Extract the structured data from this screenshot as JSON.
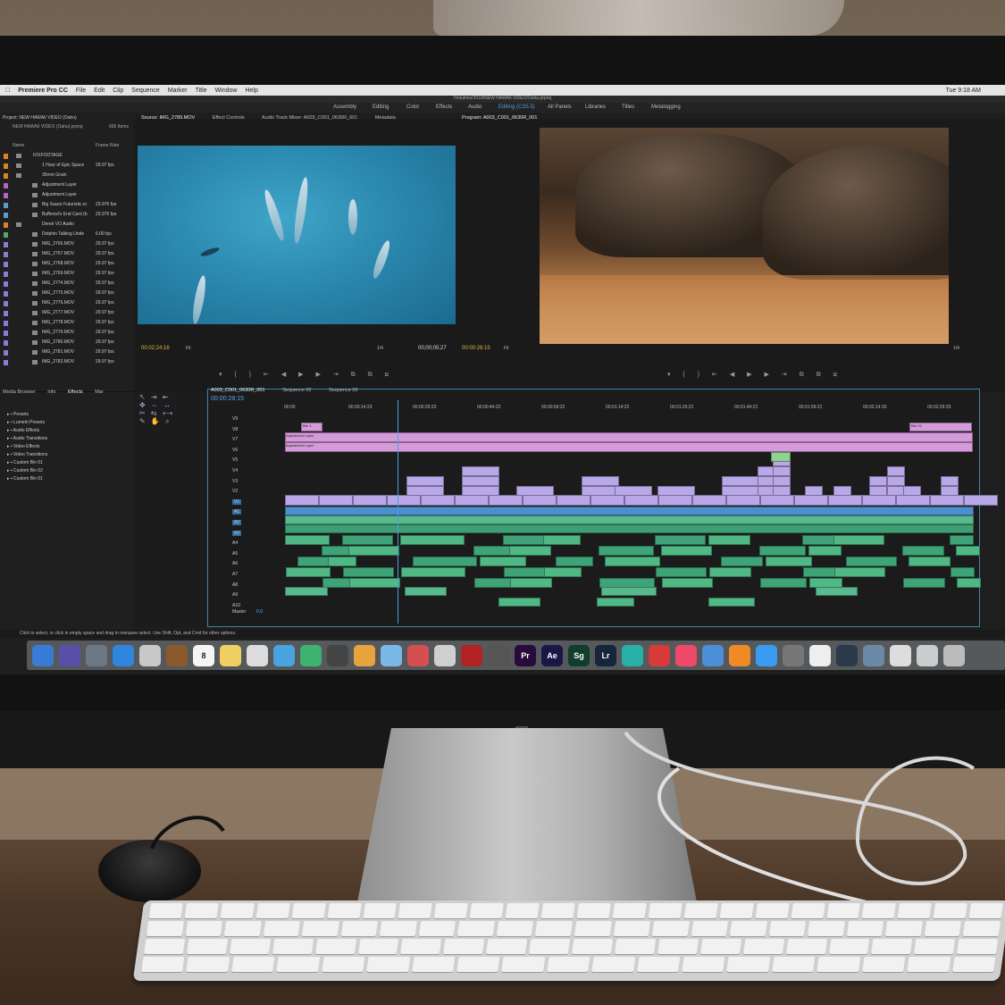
{
  "menubar": {
    "app_name": "Premiere Pro CC",
    "items": [
      "File",
      "Edit",
      "Clip",
      "Sequence",
      "Marker",
      "Title",
      "Window",
      "Help"
    ],
    "clock": "Tue 9:18 AM"
  },
  "window_title": "/Volumes/2018/NEW HAWAII VIDEO/Oahu.prproj",
  "workspaces": [
    "Assembly",
    "Editing",
    "Color",
    "Effects",
    "Audio",
    "Editing (CS5.5)",
    "All Panels",
    "Libraries",
    "Titles",
    "Metalogging"
  ],
  "project_panel": {
    "title": "Project: NEW HAWAII VIDEO (Oahu)",
    "file": "NEW HAWAII VIDEO (Oahu).prproj",
    "item_count": "665 Items",
    "columns": [
      "Name",
      "Frame Rate"
    ],
    "rows": [
      {
        "name": "IOXFOOTAGE",
        "fps": "",
        "color": "#d9822b"
      },
      {
        "name": "1 Hour of Epic Space",
        "fps": "29.97 fps",
        "color": "#d9822b"
      },
      {
        "name": "35mm Grain",
        "fps": "",
        "color": "#d9822b"
      },
      {
        "name": "Adjustment Layer",
        "fps": "",
        "color": "#b565c8"
      },
      {
        "name": "Adjustment Layer",
        "fps": "",
        "color": "#b565c8"
      },
      {
        "name": "Big Sauce Futuristic.m",
        "fps": "23.976 fps",
        "color": "#5c9ad6"
      },
      {
        "name": "Buffered's End Card (b",
        "fps": "23.976 fps",
        "color": "#5c9ad6"
      },
      {
        "name": "Derek VO Audio",
        "fps": "",
        "color": "#d9822b"
      },
      {
        "name": "Dolphin Talking Unde",
        "fps": "6.00 fps",
        "color": "#4cae6b"
      },
      {
        "name": "IMG_2766.MOV",
        "fps": "29.97 fps",
        "color": "#8c7ad8"
      },
      {
        "name": "IMG_2767.MOV",
        "fps": "29.97 fps",
        "color": "#8c7ad8"
      },
      {
        "name": "IMG_2768.MOV",
        "fps": "29.97 fps",
        "color": "#8c7ad8"
      },
      {
        "name": "IMG_2769.MOV",
        "fps": "29.97 fps",
        "color": "#8c7ad8"
      },
      {
        "name": "IMG_2774.MOV",
        "fps": "29.97 fps",
        "color": "#8c7ad8"
      },
      {
        "name": "IMG_2775.MOV",
        "fps": "29.97 fps",
        "color": "#8c7ad8"
      },
      {
        "name": "IMG_2776.MOV",
        "fps": "29.97 fps",
        "color": "#8c7ad8"
      },
      {
        "name": "IMG_2777.MOV",
        "fps": "29.97 fps",
        "color": "#8c7ad8"
      },
      {
        "name": "IMG_2778.MOV",
        "fps": "29.97 fps",
        "color": "#8c7ad8"
      },
      {
        "name": "IMG_2779.MOV",
        "fps": "29.97 fps",
        "color": "#8c7ad8"
      },
      {
        "name": "IMG_2780.MOV",
        "fps": "29.97 fps",
        "color": "#8c7ad8"
      },
      {
        "name": "IMG_2781.MOV",
        "fps": "29.97 fps",
        "color": "#8c7ad8"
      },
      {
        "name": "IMG_2782.MOV",
        "fps": "29.97 fps",
        "color": "#8c7ad8"
      }
    ]
  },
  "source_panel": {
    "tabs": [
      "Source: IMG_2789.MOV",
      "Effect Controls",
      "Audio Track Mixer: A003_C001_0630R_001",
      "Metadata"
    ],
    "timecode": "00;02;24;16",
    "fit": "Fit",
    "scale": "1/4",
    "duration": "00;00;05;27"
  },
  "program_panel": {
    "tab": "Program: A003_C001_0630R_001",
    "timecode": "00:00:28:15",
    "fit": "Fit",
    "scale": "1/4"
  },
  "effects_panel": {
    "tabs": [
      "Media Browser",
      "Info",
      "Effects",
      "Mar"
    ],
    "items": [
      "Presets",
      "Lumetri Presets",
      "Audio Effects",
      "Audio Transitions",
      "Video Effects",
      "Video Transitions",
      "Custom Bin 01",
      "Custom Bin 02",
      "Custom Bin 01"
    ]
  },
  "timeline": {
    "tabs": [
      "A003_C001_0630R_001",
      "Sequence 02",
      "Sequence 03"
    ],
    "timecode": "00:00:28:15",
    "ruler": [
      "00:00",
      "00:00:14:23",
      "00:00:29:23",
      "00:00:44:22",
      "00:00:59:22",
      "00:01:14:22",
      "00:01:29:21",
      "00:01:44:21",
      "00:01:59:21",
      "00:02:14:20",
      "00:02:29:20"
    ],
    "video_tracks": [
      "V9",
      "V8",
      "V7",
      "V6",
      "V5",
      "V4",
      "V3",
      "V2",
      "V1"
    ],
    "audio_tracks": [
      "A1",
      "A2",
      "A3",
      "A4",
      "A5",
      "A6",
      "A7",
      "A8",
      "A9",
      "A10"
    ],
    "master_label": "Master",
    "master_value": "0.0",
    "title_clip_1": "Title 1",
    "title_clip_2": "Title 01",
    "adjustment_label": "Adjustment Layer"
  },
  "status_bar": "Click to select, or click in empty space and drag to marquee select. Use Shift, Opt, and Cmd for other options.",
  "dock": [
    {
      "label": "",
      "color": "#3a7bd5"
    },
    {
      "label": "",
      "color": "#5a4fa8"
    },
    {
      "label": "",
      "color": "#6d7785"
    },
    {
      "label": "",
      "color": "#2e86de"
    },
    {
      "label": "",
      "color": "#c8c8c8"
    },
    {
      "label": "",
      "color": "#8b5a2b"
    },
    {
      "label": "8",
      "color": "#f5f5f5"
    },
    {
      "label": "",
      "color": "#f0d060"
    },
    {
      "label": "",
      "color": "#dcdcdc"
    },
    {
      "label": "",
      "color": "#4aa3df"
    },
    {
      "label": "",
      "color": "#3cb371"
    },
    {
      "label": "",
      "color": "#444"
    },
    {
      "label": "",
      "color": "#e8a33d"
    },
    {
      "label": "",
      "color": "#7ab8e8"
    },
    {
      "label": "",
      "color": "#d45050"
    },
    {
      "label": "",
      "color": "#cfcfcf"
    },
    {
      "label": "",
      "color": "#b22222"
    },
    {
      "label": "",
      "color": "#555"
    },
    {
      "label": "Pr",
      "color": "#2a0a3d"
    },
    {
      "label": "Ae",
      "color": "#1a1747"
    },
    {
      "label": "Sg",
      "color": "#123d2a"
    },
    {
      "label": "Lr",
      "color": "#15253a"
    },
    {
      "label": "",
      "color": "#28b0a8"
    },
    {
      "label": "",
      "color": "#d83a3a"
    },
    {
      "label": "",
      "color": "#f04a6a"
    },
    {
      "label": "",
      "color": "#4a8fd8"
    },
    {
      "label": "",
      "color": "#f08a24"
    },
    {
      "label": "",
      "color": "#3a9cf0"
    },
    {
      "label": "",
      "color": "#777"
    },
    {
      "label": "",
      "color": "#eee"
    },
    {
      "label": "",
      "color": "#2a3a4a"
    },
    {
      "label": "",
      "color": "#6a8aa8"
    },
    {
      "label": "",
      "color": "#ddd"
    },
    {
      "label": "",
      "color": "#ccc"
    },
    {
      "label": "",
      "color": "#bbb"
    }
  ]
}
